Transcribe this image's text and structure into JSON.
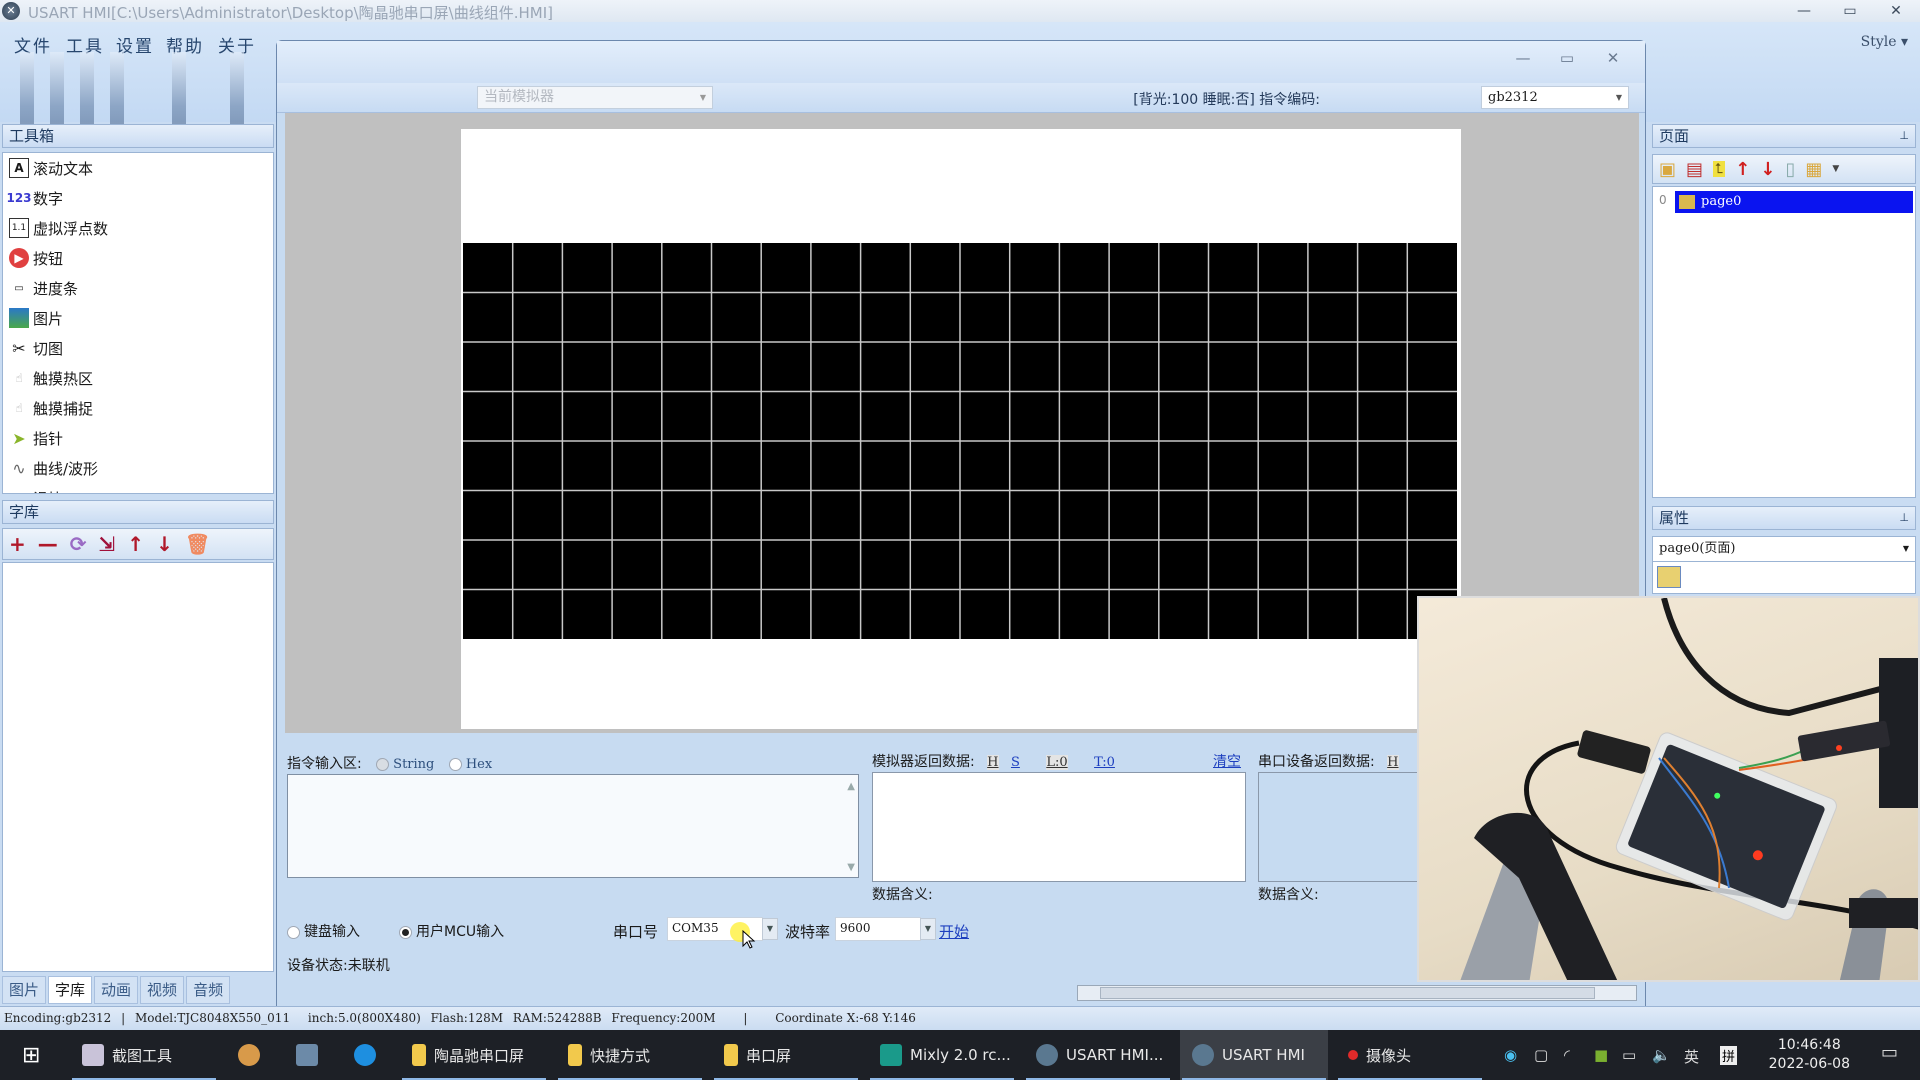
{
  "window": {
    "title": "USART HMI[C:\\Users\\Administrator\\Desktop\\陶晶驰串口屏\\曲线组件.HMI]",
    "controls": {
      "minimize": "—",
      "maximize": "▭",
      "close": "✕"
    }
  },
  "menu": [
    "文件",
    "工具",
    "设置",
    "帮助",
    "关于"
  ],
  "style_menu": "Style ▾",
  "toolbox": {
    "title": "工具箱",
    "items": [
      {
        "label": "滚动文本",
        "icon": "scroll-text-icon"
      },
      {
        "label": "数字",
        "icon": "number-icon"
      },
      {
        "label": "虚拟浮点数",
        "icon": "float-icon"
      },
      {
        "label": "按钮",
        "icon": "button-icon"
      },
      {
        "label": "进度条",
        "icon": "progress-bar-icon"
      },
      {
        "label": "图片",
        "icon": "picture-icon"
      },
      {
        "label": "切图",
        "icon": "scissors-icon"
      },
      {
        "label": "触摸热区",
        "icon": "touch-hotspot-icon"
      },
      {
        "label": "触摸捕捉",
        "icon": "touch-capture-icon"
      },
      {
        "label": "指针",
        "icon": "pointer-icon"
      },
      {
        "label": "曲线/波形",
        "icon": "waveform-icon"
      },
      {
        "label": "滑块",
        "icon": "slider-icon"
      }
    ]
  },
  "fontlib": {
    "title": "字库",
    "tools": [
      {
        "glyph": "+",
        "name": "add-icon",
        "color": "#b0182a"
      },
      {
        "glyph": "—",
        "name": "remove-icon",
        "color": "#b0182a"
      },
      {
        "glyph": "⟳",
        "name": "refresh-icon",
        "color": "#9a6bc4"
      },
      {
        "glyph": "⇲",
        "name": "export-icon",
        "color": "#a0103a"
      },
      {
        "glyph": "↑",
        "name": "move-up-icon",
        "color": "#b0182a"
      },
      {
        "glyph": "↓",
        "name": "move-down-icon",
        "color": "#b0182a"
      },
      {
        "glyph": "🗑",
        "name": "delete-icon",
        "color": "#f08a60"
      }
    ]
  },
  "bottom_tabs": [
    {
      "label": "图片",
      "active": false
    },
    {
      "label": "字库",
      "active": true
    },
    {
      "label": "动画",
      "active": false
    },
    {
      "label": "视频",
      "active": false
    },
    {
      "label": "音频",
      "active": false
    }
  ],
  "simulator": {
    "selector_placeholder": "当前模拟器",
    "status_info": "[背光:100  睡眠:否]  指令编码:",
    "encoding": "gb2312",
    "window_controls": {
      "minimize": "—",
      "maximize": "▭",
      "close": "✕"
    },
    "grid": {
      "columns": 20,
      "rows": 8
    },
    "cmd_label": "指令输入区:",
    "cmd_modes": [
      {
        "label": "String",
        "selected": true
      },
      {
        "label": "Hex",
        "selected": false
      }
    ],
    "cmd_value": "",
    "sim_return_label": "模拟器返回数据:",
    "sim_return_links": {
      "h": "H",
      "s": "S",
      "l": "L:0",
      "t": "T:0"
    },
    "clear_label": "清空",
    "sim_return_value": "",
    "sim_meaning_label": "数据含义:",
    "dev_return_label": "串口设备返回数据:",
    "dev_return_h": "H",
    "dev_meaning_label": "数据含义:",
    "input_modes": [
      {
        "label": "键盘输入",
        "selected": false
      },
      {
        "label": "用户MCU输入",
        "selected": true
      }
    ],
    "port_label": "串口号",
    "port_value": "COM35",
    "baud_label": "波特率",
    "baud_value": "9600",
    "start_label": "开始",
    "device_status": "设备状态:未联机"
  },
  "pages_panel": {
    "title": "页面",
    "pin": "📌",
    "pages": [
      {
        "index": "0",
        "name": "page0",
        "selected": true
      }
    ]
  },
  "properties_panel": {
    "title": "属性",
    "selected": "page0(页面)"
  },
  "statusbar": {
    "encoding": "Encoding:gb2312",
    "model": "Model:TJC8048X550_011",
    "inch": "inch:5.0(800X480)",
    "flash": "Flash:128M",
    "ram": "RAM:524288B",
    "frequency": "Frequency:200M",
    "coordinate": "Coordinate X:-68  Y:146"
  },
  "taskbar": {
    "items": [
      {
        "label": "截图工具",
        "icon_color": "#c9c3d9"
      },
      {
        "label": "",
        "icon_color": "#d89a4a"
      },
      {
        "label": "",
        "icon_color": "#6c8aa8"
      },
      {
        "label": "",
        "icon_color": "#1e8fe0"
      },
      {
        "label": "陶晶驰串口屏",
        "icon_color": "#f2c94c"
      },
      {
        "label": "快捷方式",
        "icon_color": "#f2c94c"
      },
      {
        "label": "串口屏",
        "icon_color": "#f2c94c"
      },
      {
        "label": "Mixly 2.0 rc...",
        "icon_color": "#1a9a8a"
      },
      {
        "label": "USART HMI...",
        "icon_color": "#5a7890"
      },
      {
        "label": "USART HMI",
        "icon_color": "#5a7890"
      },
      {
        "label": "摄像头",
        "icon_color": "#e02a2a"
      }
    ],
    "tray": {
      "ime_lang": "英",
      "ime_mode": "拼"
    },
    "time": "10:46:48",
    "date": "2022-06-08"
  }
}
